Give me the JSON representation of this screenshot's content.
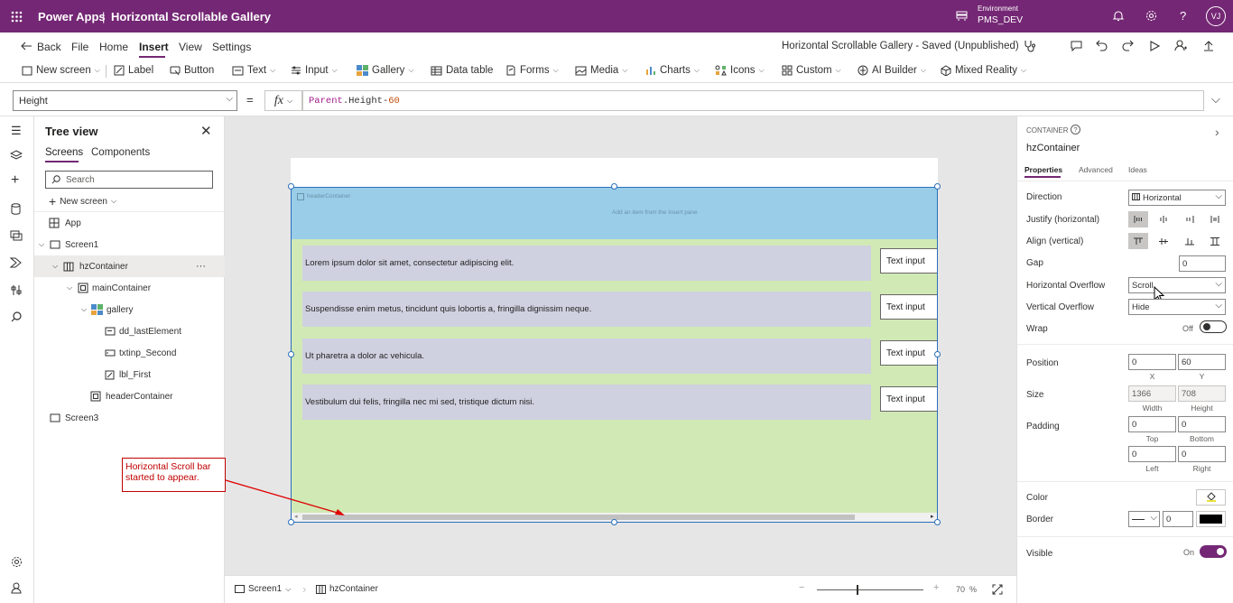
{
  "app": {
    "name": "Power Apps",
    "separator": "|",
    "title": "Horizontal Scrollable Gallery"
  },
  "environment": {
    "label": "Environment",
    "name": "PMS_DEV"
  },
  "user": {
    "initials": "VJ"
  },
  "menu": {
    "back": "Back",
    "items": [
      "File",
      "Home",
      "Insert",
      "View",
      "Settings"
    ],
    "active": "Insert",
    "save_status": "Horizontal Scrollable Gallery - Saved (Unpublished)"
  },
  "ribbon": {
    "new_screen": "New screen",
    "label": "Label",
    "button": "Button",
    "text": "Text",
    "input": "Input",
    "gallery": "Gallery",
    "data_table": "Data table",
    "forms": "Forms",
    "media": "Media",
    "charts": "Charts",
    "icons": "Icons",
    "custom": "Custom",
    "ai_builder": "AI Builder",
    "mixed_reality": "Mixed Reality"
  },
  "formula": {
    "property": "Height",
    "equals": "=",
    "fx": "fx",
    "expr_obj": "Parent",
    "expr_dot": ".",
    "expr_prop": "Height",
    "expr_op": "-",
    "expr_num": "60"
  },
  "tree": {
    "title": "Tree view",
    "tabs": [
      "Screens",
      "Components"
    ],
    "search_placeholder": "Search",
    "new_screen": "New screen",
    "items": {
      "app": "App",
      "screen1": "Screen1",
      "hz": "hzContainer",
      "main": "mainContainer",
      "gallery": "gallery",
      "dd": "dd_lastElement",
      "txt": "txtinp_Second",
      "lbl": "lbl_First",
      "header": "headerContainer",
      "screen3": "Screen3"
    },
    "more": "···"
  },
  "canvas": {
    "header_name": "headerContainer",
    "header_hint": "Add an item from the Insert pane",
    "rows": [
      {
        "text": "Lorem ipsum dolor sit amet, consectetur adipiscing elit.",
        "input": "Text input"
      },
      {
        "text": "Suspendisse enim metus, tincidunt quis lobortis a, fringilla dignissim neque.",
        "input": "Text input"
      },
      {
        "text": "Ut pharetra a dolor ac vehicula.",
        "input": "Text input"
      },
      {
        "text": "Vestibulum dui felis, fringilla nec mi sed, tristique dictum nisi.",
        "input": "Text input"
      }
    ],
    "callout": "Horizontal Scroll bar started to appear."
  },
  "bottom": {
    "screen": "Screen1",
    "control": "hzContainer",
    "zoom": "70",
    "zoom_unit": "%"
  },
  "props": {
    "type": "CONTAINER",
    "name": "hzContainer",
    "tabs": [
      "Properties",
      "Advanced",
      "Ideas"
    ],
    "direction_label": "Direction",
    "direction": "Horizontal",
    "justify_label": "Justify (horizontal)",
    "align_label": "Align (vertical)",
    "gap_label": "Gap",
    "gap": "0",
    "hoverflow_label": "Horizontal Overflow",
    "hoverflow": "Scroll",
    "voverflow_label": "Vertical Overflow",
    "voverflow": "Hide",
    "wrap_label": "Wrap",
    "wrap_state": "Off",
    "position_label": "Position",
    "pos_x": "0",
    "pos_y": "60",
    "x_label": "X",
    "y_label": "Y",
    "size_label": "Size",
    "width": "1366",
    "height": "708",
    "w_label": "Width",
    "h_label": "Height",
    "padding_label": "Padding",
    "pad_top": "0",
    "pad_bottom": "0",
    "pad_left": "0",
    "pad_right": "0",
    "top_label": "Top",
    "bottom_label": "Bottom",
    "left_label": "Left",
    "right_label": "Right",
    "color_label": "Color",
    "border_label": "Border",
    "border_width": "0",
    "visible_label": "Visible",
    "visible_state": "On"
  },
  "colors": {
    "brand": "#742774",
    "header_blue": "#99cde8",
    "main_green": "#d1e9b5",
    "gallery_row": "#cfd1e0",
    "callout_red": "#c00000"
  }
}
